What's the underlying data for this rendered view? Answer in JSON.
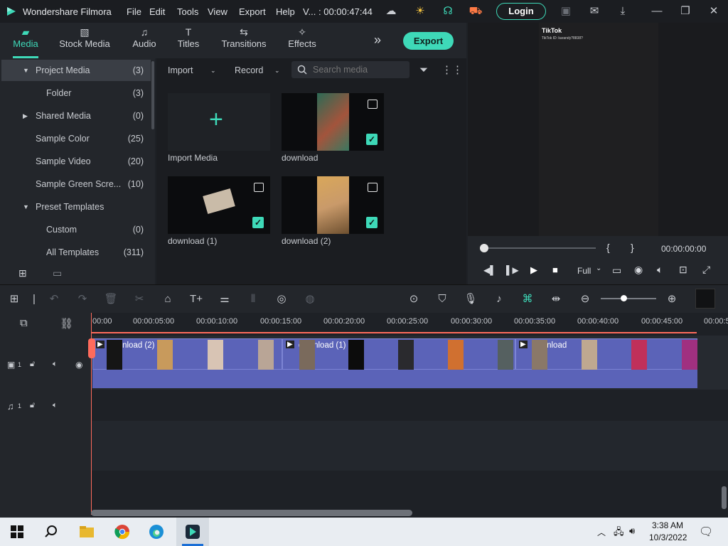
{
  "titlebar": {
    "app_name": "Wondershare Filmora",
    "menu": [
      "File",
      "Edit",
      "Tools",
      "View",
      "Export",
      "Help"
    ],
    "project_abbrev": "V...",
    "timecode": ": 00:00:47:44",
    "login_label": "Login"
  },
  "tabs": [
    {
      "label": "Media",
      "icon": "folder-media-icon",
      "active": true
    },
    {
      "label": "Stock Media",
      "icon": "image-icon"
    },
    {
      "label": "Audio",
      "icon": "music-icon"
    },
    {
      "label": "Titles",
      "icon": "text-icon"
    },
    {
      "label": "Transitions",
      "icon": "transition-icon"
    },
    {
      "label": "Effects",
      "icon": "effects-icon"
    }
  ],
  "export_label": "Export",
  "sidebar": {
    "items": [
      {
        "label": "Project Media",
        "count": "(3)",
        "expanded": true,
        "selected": true
      },
      {
        "label": "Folder",
        "count": "(3)"
      },
      {
        "label": "Shared Media",
        "count": "(0)",
        "collapsed": true
      },
      {
        "label": "Sample Color",
        "count": "(25)"
      },
      {
        "label": "Sample Video",
        "count": "(20)"
      },
      {
        "label": "Sample Green Scre...",
        "count": "(10)"
      },
      {
        "label": "Preset Templates",
        "expanded": true
      },
      {
        "label": "Custom",
        "count": "(0)"
      },
      {
        "label": "All Templates",
        "count": "(311)"
      }
    ]
  },
  "media_toolbar": {
    "import_label": "Import",
    "record_label": "Record",
    "search_placeholder": "Search media"
  },
  "media_items": [
    {
      "label": "Import Media",
      "kind": "import"
    },
    {
      "label": "download",
      "kind": "video",
      "checked": true
    },
    {
      "label": "download (1)",
      "kind": "video",
      "checked": true
    },
    {
      "label": "download (2)",
      "kind": "video",
      "checked": true
    }
  ],
  "preview": {
    "watermark": "TikTok",
    "watermark_sub": "TikTok ID: karandy?8838?",
    "timecode": "00:00:00:00",
    "quality": "Full",
    "progress": 0
  },
  "ruler_ticks": [
    "00:00",
    "00:00:05:00",
    "00:00:10:00",
    "00:00:15:00",
    "00:00:20:00",
    "00:00:25:00",
    "00:00:30:00",
    "00:00:35:00",
    "00:00:40:00",
    "00:00:45:00",
    "00:00:5"
  ],
  "tracks": {
    "video_label": "1",
    "audio_label": "1"
  },
  "clips": [
    {
      "label": "download (2)"
    },
    {
      "label": "download (1)"
    },
    {
      "label": "download"
    }
  ],
  "taskbar": {
    "time": "3:38 AM",
    "date": "10/3/2022"
  },
  "colors": {
    "accent": "#3ed9b8",
    "clip": "#5b63b8",
    "playhead": "#ff6b5c"
  }
}
